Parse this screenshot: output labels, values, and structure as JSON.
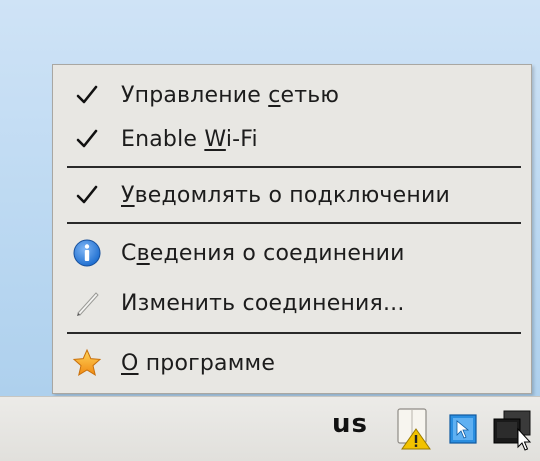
{
  "menu": {
    "items": [
      {
        "pre": "Управление ",
        "key": "с",
        "post": "етью",
        "checked": true,
        "icon": "check-icon"
      },
      {
        "pre": "Enable ",
        "key": "W",
        "post": "i-Fi",
        "checked": true,
        "icon": "check-icon"
      },
      {
        "pre": "",
        "key": "У",
        "post": "ведомлять о подключении",
        "checked": true,
        "icon": "check-icon"
      },
      {
        "pre": "С",
        "key": "в",
        "post": "едения о соединении",
        "checked": false,
        "icon": "info-icon"
      },
      {
        "pre": "Изменить соединения...",
        "key": "",
        "post": "",
        "checked": false,
        "icon": "edit-pen-icon"
      },
      {
        "pre": "",
        "key": "О",
        "post": " программе",
        "checked": false,
        "icon": "star-icon"
      }
    ]
  },
  "taskbar": {
    "keyboard_layout": "us",
    "tray_icons": [
      "network-warning-icon",
      "cursor-window-icon",
      "network-manager-icon"
    ]
  },
  "colors": {
    "menu_bg": "#e8e7e3",
    "desktop_bg": "#b9d7f1",
    "info_blue": "#1f6fd0",
    "star_orange": "#f5a623",
    "warning_yellow": "#f2c200"
  }
}
